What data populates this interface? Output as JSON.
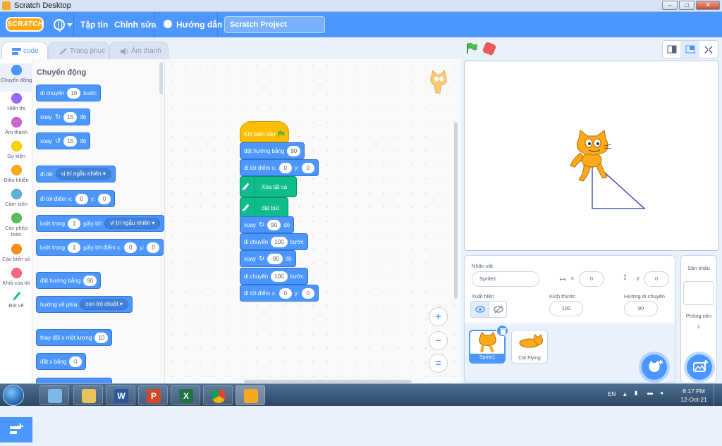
{
  "window": {
    "title": "Scratch Desktop",
    "min": "–",
    "max": "□",
    "close": "✕"
  },
  "menu": {
    "logo": "SCRATCH",
    "file": "Tập tin",
    "edit": "Chỉnh sửa",
    "tutorials": "Hướng dẫn",
    "project_title": "Scratch Project"
  },
  "tabs": {
    "code": "code",
    "costumes": "Trang phục",
    "sounds": "Âm thanh"
  },
  "categories": [
    {
      "label": "Chuyển động",
      "color": "#4c97ff"
    },
    {
      "label": "Hiển thị",
      "color": "#9966ff"
    },
    {
      "label": "Âm thanh",
      "color": "#cf63cf"
    },
    {
      "label": "Sự kiện",
      "color": "#ffd500"
    },
    {
      "label": "Điều khiển",
      "color": "#ffab19"
    },
    {
      "label": "Cảm biến",
      "color": "#5cb1d6"
    },
    {
      "label": "Các phép toán",
      "color": "#59c059"
    },
    {
      "label": "Các biến số",
      "color": "#ff8c1a"
    },
    {
      "label": "Khối của tôi",
      "color": "#ff6680"
    },
    {
      "label": "Bút vẽ",
      "color": "#0fbd8c"
    }
  ],
  "palette": {
    "title": "Chuyển động",
    "move": {
      "a": "di chuyển",
      "v": "10",
      "b": "bước"
    },
    "turn_right": {
      "a": "xoay",
      "icon": "↻",
      "v": "15",
      "b": "độ"
    },
    "turn_left": {
      "a": "xoay",
      "icon": "↺",
      "v": "15",
      "b": "độ"
    },
    "goto": {
      "a": "đi tới",
      "dd": "vị trí ngẫu nhiên ▾"
    },
    "goto_xy": {
      "a": "đi tới điểm x:",
      "x": "0",
      "yl": "y:",
      "y": "0"
    },
    "glide": {
      "a": "lướt trong",
      "v": "1",
      "b": "giây tới",
      "dd": "vị trí ngẫu nhiên ▾"
    },
    "glide_xy": {
      "a": "lướt trong",
      "v": "1",
      "b": "giây tới điểm x:",
      "x": "0",
      "yl": "y:",
      "y": "0"
    },
    "point": {
      "a": "đặt hướng bằng",
      "v": "90"
    },
    "point_towards": {
      "a": "hướng về phía",
      "dd": "con trỏ chuột ▾"
    },
    "change_x": {
      "a": "thay đổi x một lượng",
      "v": "10"
    },
    "set_x": {
      "a": "đặt x bằng",
      "v": "0"
    }
  },
  "script": {
    "hat": "Khi bấm vào",
    "point": {
      "a": "đặt hướng bằng",
      "v": "90"
    },
    "goto_xy": {
      "a": "đi tới điểm x:",
      "x": "0",
      "yl": "y:",
      "y": "0"
    },
    "clear": "Xóa tất cả",
    "pen_down": "đặt bút",
    "turn1": {
      "a": "xoay",
      "icon": "↻",
      "v": "90",
      "b": "độ"
    },
    "move1": {
      "a": "di chuyển",
      "v": "100",
      "b": "bước"
    },
    "turn2": {
      "a": "xoay",
      "icon": "↻",
      "v": "-90",
      "b": "độ"
    },
    "move2": {
      "a": "di chuyển",
      "v": "100",
      "b": "bước"
    },
    "goto_xy2": {
      "a": "đi tới điểm x:",
      "x": "0",
      "yl": "y:",
      "y": "0"
    }
  },
  "zoom": {
    "in": "+",
    "out": "−",
    "reset": "="
  },
  "sprite_info": {
    "sprite_label": "Nhân vật",
    "sprite_name": "Sprite1",
    "x_label": "x",
    "x": "0",
    "y_label": "y",
    "y": "0",
    "show_label": "Xuất hiện",
    "size_label": "Kích thước",
    "size": "100",
    "direction_label": "Hướng di chuyển",
    "direction": "90"
  },
  "sprites": [
    {
      "name": "Sprite1"
    },
    {
      "name": "Cat Flying"
    }
  ],
  "stage_panel": {
    "title": "Sân khấu",
    "backdrops_label": "Phông nền",
    "backdrops_count": "1"
  },
  "taskbar": {
    "lang": "EN",
    "time": "8:17 PM",
    "date": "12-Oct-21",
    "apps": [
      {
        "icon": "W",
        "color": "#2b579a"
      },
      {
        "icon": "P",
        "color": "#d24726"
      },
      {
        "icon": "X",
        "color": "#217346"
      }
    ]
  }
}
